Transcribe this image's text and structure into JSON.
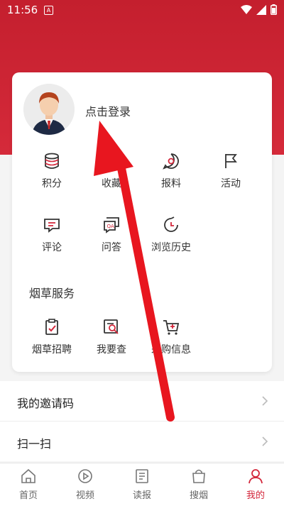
{
  "status_bar": {
    "time": "11:56",
    "notif_glyph": "A"
  },
  "profile": {
    "login_text": "点击登录"
  },
  "grid_row1": [
    {
      "label": "积分",
      "icon": "points-icon"
    },
    {
      "label": "收藏",
      "icon": "favorite-icon"
    },
    {
      "label": "报料",
      "icon": "report-icon"
    },
    {
      "label": "活动",
      "icon": "flag-icon"
    }
  ],
  "grid_row2": [
    {
      "label": "评论",
      "icon": "comment-icon"
    },
    {
      "label": "问答",
      "icon": "qa-icon"
    },
    {
      "label": "浏览历史",
      "icon": "history-icon"
    }
  ],
  "tobacco": {
    "title": "烟草服务",
    "items": [
      {
        "label": "烟草招聘",
        "icon": "recruit-icon"
      },
      {
        "label": "我要查",
        "icon": "lookup-icon"
      },
      {
        "label": "采购信息",
        "icon": "cart-icon"
      }
    ]
  },
  "list": [
    {
      "label": "我的邀请码"
    },
    {
      "label": "扫一扫"
    }
  ],
  "tabbar": [
    {
      "label": "首页",
      "icon": "home-icon"
    },
    {
      "label": "视频",
      "icon": "video-icon"
    },
    {
      "label": "读报",
      "icon": "newspaper-icon"
    },
    {
      "label": "搜烟",
      "icon": "shopping-bag-icon"
    },
    {
      "label": "我的",
      "icon": "user-icon",
      "active": true
    }
  ],
  "colors": {
    "brand_red": "#d3263a",
    "arrow": "#e8161f"
  }
}
